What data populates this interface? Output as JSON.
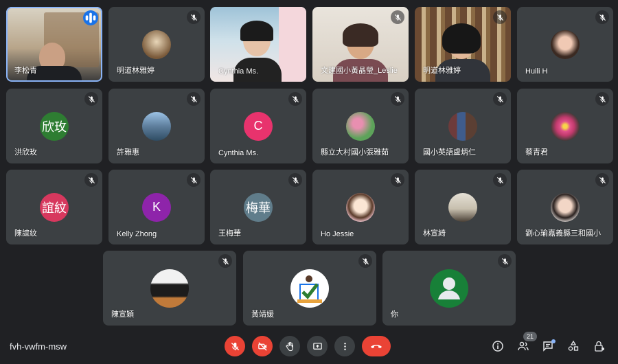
{
  "meeting": {
    "code": "fvh-vwfm-msw",
    "participant_count": "21"
  },
  "colors": {
    "background": "#202124",
    "tile": "#3c4043",
    "danger": "#ea4335",
    "accent": "#1a73e8"
  },
  "tiles": [
    {
      "name": "李松青",
      "type": "video",
      "speaking": true
    },
    {
      "name": "明道林雅婷",
      "type": "photo-avatar",
      "muted": true
    },
    {
      "name": "Cynthia Ms.",
      "type": "video"
    },
    {
      "name": "文建國小黃晶瑩_Leslie",
      "type": "video",
      "muted": true
    },
    {
      "name": "明道林雅婷",
      "type": "video",
      "muted": true
    },
    {
      "name": "Huili H",
      "type": "photo-avatar",
      "muted": true
    },
    {
      "name": "洪欣玫",
      "type": "initials",
      "initials": "欣玫",
      "color": "#2e7d32",
      "muted": true
    },
    {
      "name": "許雅惠",
      "type": "photo-avatar",
      "muted": true
    },
    {
      "name": "Cynthia Ms.",
      "type": "initials",
      "initials": "C",
      "color": "#e8336d",
      "muted": true
    },
    {
      "name": "縣立大村國小張雅茹",
      "type": "photo-avatar",
      "muted": true
    },
    {
      "name": "國小英語盧炳仁",
      "type": "photo-avatar",
      "muted": true
    },
    {
      "name": "蔡青君",
      "type": "photo-avatar",
      "muted": true
    },
    {
      "name": "陳誼紋",
      "type": "initials",
      "initials": "誼紋",
      "color": "#d7385e",
      "muted": true
    },
    {
      "name": "Kelly Zhong",
      "type": "initials",
      "initials": "K",
      "color": "#8e24aa",
      "muted": true
    },
    {
      "name": "王梅華",
      "type": "initials",
      "initials": "梅華",
      "color": "#607d8b",
      "muted": true
    },
    {
      "name": "Ho Jessie",
      "type": "photo-avatar",
      "muted": true
    },
    {
      "name": "林宣綺",
      "type": "photo-avatar",
      "muted": true
    },
    {
      "name": "劉心瑜嘉義縣三和國小",
      "type": "photo-avatar",
      "muted": true
    },
    {
      "name": "陳宣穎",
      "type": "photo-avatar",
      "muted": true
    },
    {
      "name": "黃靖媛",
      "type": "photo-avatar",
      "muted": true
    },
    {
      "name": "你",
      "type": "default-avatar",
      "muted": true
    }
  ],
  "controls": [
    {
      "label": "microphone-off",
      "icon": "mic-off-icon"
    },
    {
      "label": "camera-off",
      "icon": "camera-off-icon"
    },
    {
      "label": "raise-hand",
      "icon": "hand-icon"
    },
    {
      "label": "present",
      "icon": "present-icon"
    },
    {
      "label": "more-options",
      "icon": "more-vert-icon"
    },
    {
      "label": "leave-call",
      "icon": "end-call-icon"
    }
  ]
}
